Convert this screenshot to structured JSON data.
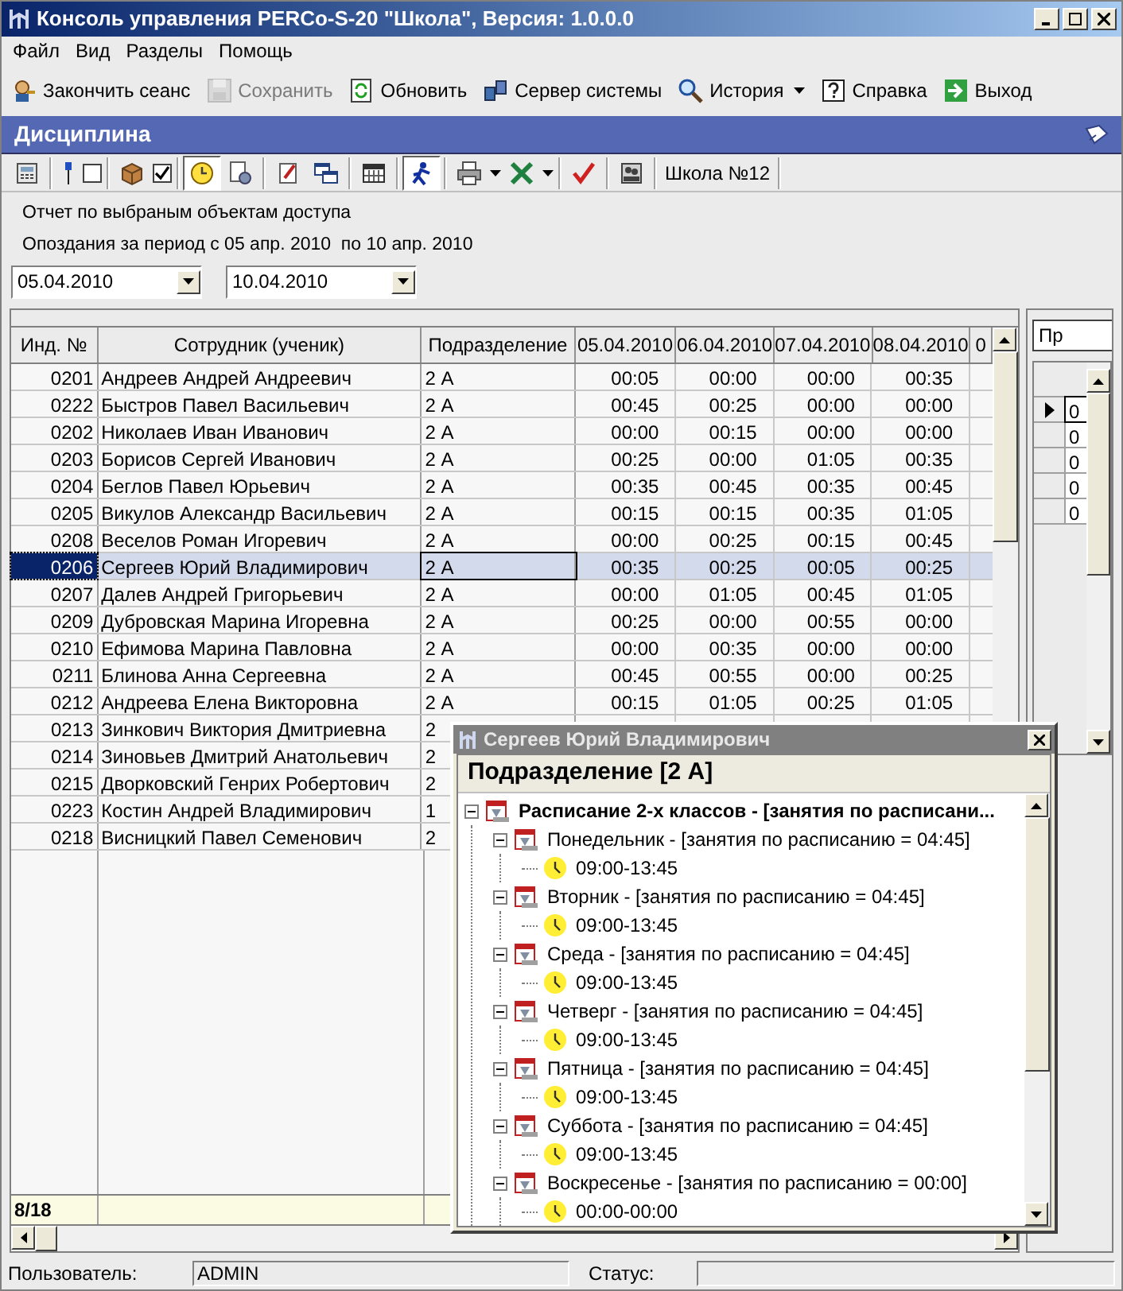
{
  "window": {
    "title": "Консоль управления PERCo-S-20 \"Школа\", Версия: 1.0.0.0"
  },
  "menu": [
    "Файл",
    "Вид",
    "Разделы",
    "Помощь"
  ],
  "toolbar": [
    {
      "label": "Закончить сеанс",
      "kind": "logout",
      "disabled": false,
      "dropdown": false
    },
    {
      "label": "Сохранить",
      "kind": "save",
      "disabled": true,
      "dropdown": false
    },
    {
      "label": "Обновить",
      "kind": "refresh",
      "disabled": false,
      "dropdown": false
    },
    {
      "label": "Сервер системы",
      "kind": "server",
      "disabled": false,
      "dropdown": false
    },
    {
      "label": "История",
      "kind": "search",
      "disabled": false,
      "dropdown": true
    },
    {
      "label": "Справка",
      "kind": "help",
      "disabled": false,
      "dropdown": false
    },
    {
      "label": "Выход",
      "kind": "exit",
      "disabled": false,
      "dropdown": false
    }
  ],
  "section": {
    "title": "Дисциплина"
  },
  "report_toolbar": {
    "groups": [
      [
        {
          "kind": "calculator",
          "pressed": false
        }
      ],
      [
        {
          "kind": "pin",
          "pressed": false
        },
        {
          "kind": "checkbox",
          "checked": false
        }
      ],
      [
        {
          "kind": "box",
          "pressed": false
        },
        {
          "kind": "checkbox",
          "checked": true
        }
      ],
      [
        {
          "kind": "clock",
          "pressed": true
        },
        {
          "kind": "gear",
          "pressed": false
        }
      ],
      [
        {
          "kind": "pen",
          "pressed": false
        },
        {
          "kind": "windows",
          "pressed": false
        }
      ],
      [
        {
          "kind": "calendar",
          "pressed": false
        }
      ],
      [
        {
          "kind": "runner",
          "pressed": true
        }
      ],
      [
        {
          "kind": "printer",
          "pressed": false
        },
        {
          "kind": "dropdown"
        },
        {
          "kind": "excel",
          "pressed": false
        },
        {
          "kind": "dropdown"
        }
      ],
      [
        {
          "kind": "check",
          "pressed": false
        }
      ],
      [
        {
          "kind": "stamp",
          "pressed": false
        }
      ]
    ],
    "label": "Школа №12"
  },
  "report": {
    "lines": [
      "Отчет по выбраным объектам доступа",
      "Опоздания за период с 05 апр. 2010  по 10 апр. 2010"
    ]
  },
  "date_from": {
    "value": "05.04.2010"
  },
  "date_to": {
    "value": "10.04.2010"
  },
  "table": {
    "columns": [
      "Инд. №",
      "Сотрудник (ученик)",
      "Подразделение",
      "05.04.2010",
      "06.04.2010",
      "07.04.2010",
      "08.04.2010",
      "0"
    ],
    "rows": [
      {
        "id": "0201",
        "name": "Андреев Андрей Андреевич",
        "department": "2 А",
        "times": [
          "00:05",
          "00:00",
          "00:00",
          "00:35"
        ],
        "selected": false
      },
      {
        "id": "0222",
        "name": "Быстров Павел Васильевич",
        "department": "2 А",
        "times": [
          "00:45",
          "00:25",
          "00:00",
          "00:00"
        ],
        "selected": false
      },
      {
        "id": "0202",
        "name": "Николаев Иван Иванович",
        "department": "2 А",
        "times": [
          "00:00",
          "00:15",
          "00:00",
          "00:00"
        ],
        "selected": false
      },
      {
        "id": "0203",
        "name": "Борисов Сергей Иванович",
        "department": "2 А",
        "times": [
          "00:25",
          "00:00",
          "01:05",
          "00:35"
        ],
        "selected": false
      },
      {
        "id": "0204",
        "name": "Беглов Павел Юрьевич",
        "department": "2 А",
        "times": [
          "00:35",
          "00:45",
          "00:35",
          "00:45"
        ],
        "selected": false
      },
      {
        "id": "0205",
        "name": "Викулов Александр Васильевич",
        "department": "2 А",
        "times": [
          "00:15",
          "00:15",
          "00:35",
          "01:05"
        ],
        "selected": false
      },
      {
        "id": "0208",
        "name": "Веселов Роман Игоревич",
        "department": "2 А",
        "times": [
          "00:00",
          "00:25",
          "00:15",
          "00:45"
        ],
        "selected": false
      },
      {
        "id": "0206",
        "name": "Сергеев Юрий Владимирович",
        "department": "2 А",
        "times": [
          "00:35",
          "00:25",
          "00:05",
          "00:25"
        ],
        "selected": true
      },
      {
        "id": "0207",
        "name": "Далев Андрей Григорьевич",
        "department": "2 А",
        "times": [
          "00:00",
          "01:05",
          "00:45",
          "01:05"
        ],
        "selected": false
      },
      {
        "id": "0209",
        "name": "Дубровская Марина Игоревна",
        "department": "2 А",
        "times": [
          "00:25",
          "00:00",
          "00:55",
          "00:00"
        ],
        "selected": false
      },
      {
        "id": "0210",
        "name": "Ефимова Марина Павловна",
        "department": "2 А",
        "times": [
          "00:00",
          "00:35",
          "00:00",
          "00:00"
        ],
        "selected": false
      },
      {
        "id": "0211",
        "name": "Блинова Анна Сергеевна",
        "department": "2 А",
        "times": [
          "00:45",
          "00:55",
          "00:00",
          "00:25"
        ],
        "selected": false
      },
      {
        "id": "0212",
        "name": "Андреева Елена Викторовна",
        "department": "2 А",
        "times": [
          "00:15",
          "01:05",
          "00:25",
          "01:05"
        ],
        "selected": false
      },
      {
        "id": "0213",
        "name": "Зинкович Виктория Дмитриевна",
        "department": "2",
        "times": [],
        "selected": false
      },
      {
        "id": "0214",
        "name": "Зиновьев Дмитрий Анатольевич",
        "department": "2",
        "times": [],
        "selected": false
      },
      {
        "id": "0215",
        "name": "Дворковский Генрих Робертович",
        "department": "2",
        "times": [],
        "selected": false
      },
      {
        "id": "0223",
        "name": "Костин Андрей Владимирович",
        "department": "1",
        "times": [],
        "selected": false
      },
      {
        "id": "0218",
        "name": "Висницкий Павел Семенович",
        "department": "2",
        "times": [],
        "selected": false
      }
    ],
    "footer": "8/18"
  },
  "right_panel": {
    "tab": "Пр",
    "rows": [
      {
        "value": "0",
        "current": true
      },
      {
        "value": "0",
        "current": false
      },
      {
        "value": "0",
        "current": false
      },
      {
        "value": "0",
        "current": false
      },
      {
        "value": "0",
        "current": false
      }
    ]
  },
  "popup": {
    "title": "Сергеев Юрий Владимирович",
    "header": "Подразделение [2 А]",
    "tree": [
      {
        "label": "Расписание 2-х классов - [занятия по расписани...",
        "kind": "schedule",
        "expanded": true,
        "children": [
          {
            "label": "Понедельник - [занятия по расписанию = 04:45]",
            "kind": "schedule",
            "expanded": true,
            "children": [
              {
                "label": "09:00-13:45",
                "kind": "time"
              }
            ]
          },
          {
            "label": "Вторник - [занятия по расписанию = 04:45]",
            "kind": "schedule",
            "expanded": true,
            "children": [
              {
                "label": "09:00-13:45",
                "kind": "time"
              }
            ]
          },
          {
            "label": "Среда - [занятия по расписанию = 04:45]",
            "kind": "schedule",
            "expanded": true,
            "children": [
              {
                "label": "09:00-13:45",
                "kind": "time"
              }
            ]
          },
          {
            "label": "Четверг - [занятия по расписанию = 04:45]",
            "kind": "schedule",
            "expanded": true,
            "children": [
              {
                "label": "09:00-13:45",
                "kind": "time"
              }
            ]
          },
          {
            "label": "Пятница - [занятия по расписанию = 04:45]",
            "kind": "schedule",
            "expanded": true,
            "children": [
              {
                "label": "09:00-13:45",
                "kind": "time"
              }
            ]
          },
          {
            "label": "Суббота - [занятия по расписанию = 04:45]",
            "kind": "schedule",
            "expanded": true,
            "children": [
              {
                "label": "09:00-13:45",
                "kind": "time"
              }
            ]
          },
          {
            "label": "Воскресенье - [занятия по расписанию = 00:00]",
            "kind": "schedule",
            "expanded": true,
            "children": [
              {
                "label": "00:00-00:00",
                "kind": "time"
              }
            ]
          }
        ]
      }
    ]
  },
  "status_bar": {
    "user_label": "Пользователь:",
    "user": "ADMIN",
    "status_label": "Статус:"
  }
}
